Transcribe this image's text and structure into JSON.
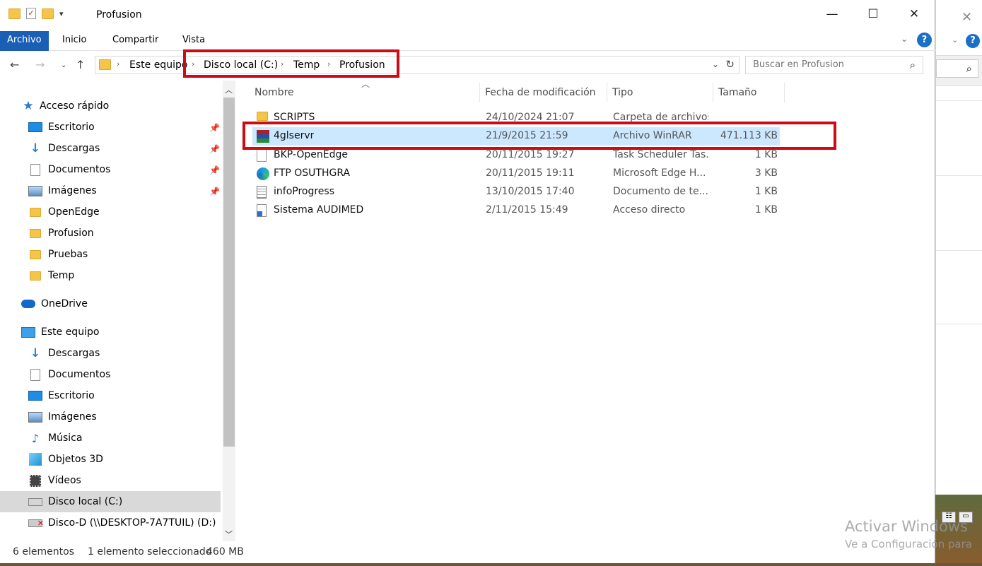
{
  "window": {
    "title": "Profusion"
  },
  "ribbon": {
    "tabs": [
      "Archivo",
      "Inicio",
      "Compartir",
      "Vista"
    ],
    "active": "Archivo",
    "help": "?"
  },
  "address": {
    "crumbs": [
      "Este equipo",
      "Disco local (C:)",
      "Temp",
      "Profusion"
    ]
  },
  "search": {
    "placeholder": "Buscar en Profusion"
  },
  "sidebar": {
    "items": [
      {
        "label": "Acceso rápido",
        "icon": "star-icon",
        "pinned": false
      },
      {
        "label": "Escritorio",
        "icon": "desktop-icon",
        "pinned": true
      },
      {
        "label": "Descargas",
        "icon": "download-icon",
        "pinned": true
      },
      {
        "label": "Documentos",
        "icon": "documents-icon",
        "pinned": true
      },
      {
        "label": "Imágenes",
        "icon": "pictures-icon",
        "pinned": true
      },
      {
        "label": "OpenEdge",
        "icon": "folder-icon",
        "pinned": false
      },
      {
        "label": "Profusion",
        "icon": "folder-icon",
        "pinned": false
      },
      {
        "label": "Pruebas",
        "icon": "folder-icon",
        "pinned": false
      },
      {
        "label": "Temp",
        "icon": "folder-icon",
        "pinned": false
      },
      {
        "label": "OneDrive",
        "icon": "cloud-icon",
        "pinned": false
      },
      {
        "label": "Este equipo",
        "icon": "computer-icon",
        "pinned": false
      },
      {
        "label": "Descargas",
        "icon": "download-icon",
        "pinned": false
      },
      {
        "label": "Documentos",
        "icon": "documents-icon",
        "pinned": false
      },
      {
        "label": "Escritorio",
        "icon": "desktop-icon",
        "pinned": false
      },
      {
        "label": "Imágenes",
        "icon": "pictures-icon",
        "pinned": false
      },
      {
        "label": "Música",
        "icon": "music-icon",
        "pinned": false
      },
      {
        "label": "Objetos 3D",
        "icon": "3d-objects-icon",
        "pinned": false
      },
      {
        "label": "Vídeos",
        "icon": "videos-icon",
        "pinned": false
      },
      {
        "label": "Disco local (C:)",
        "icon": "drive-icon",
        "pinned": false,
        "selected": true
      },
      {
        "label": "Disco-D (\\\\DESKTOP-7A7TUIL) (D:)",
        "icon": "network-drive-icon",
        "pinned": false
      }
    ]
  },
  "columns": {
    "name": "Nombre",
    "date": "Fecha de modificación",
    "type": "Tipo",
    "size": "Tamaño"
  },
  "files": [
    {
      "name": "SCRIPTS",
      "date": "24/10/2024 21:07",
      "type": "Carpeta de archivos",
      "size": "",
      "icon": "folder-icon"
    },
    {
      "name": "4glservr",
      "date": "21/9/2015 21:59",
      "type": "Archivo WinRAR",
      "size": "471.113 KB",
      "icon": "winrar-icon",
      "selected": true
    },
    {
      "name": "BKP-OpenEdge",
      "date": "20/11/2015 19:27",
      "type": "Task Scheduler Tas...",
      "size": "1 KB",
      "icon": "task-icon"
    },
    {
      "name": "FTP OSUTHGRA",
      "date": "20/11/2015 19:11",
      "type": "Microsoft Edge H...",
      "size": "3 KB",
      "icon": "edge-icon"
    },
    {
      "name": "infoProgress",
      "date": "13/10/2015 17:40",
      "type": "Documento de te...",
      "size": "1 KB",
      "icon": "text-document-icon"
    },
    {
      "name": "Sistema AUDIMED",
      "date": "2/11/2015 15:49",
      "type": "Acceso directo",
      "size": "1 KB",
      "icon": "shortcut-icon"
    }
  ],
  "status": {
    "count": "6 elementos",
    "selection": "1 elemento seleccionado",
    "size": "460 MB"
  },
  "watermark": {
    "line1": "Activar Windows",
    "line2": "Ve a Configuración para"
  },
  "colors": {
    "accent": "#1a5fb4",
    "highlight": "#cc0b14",
    "selection": "#cce8ff"
  }
}
